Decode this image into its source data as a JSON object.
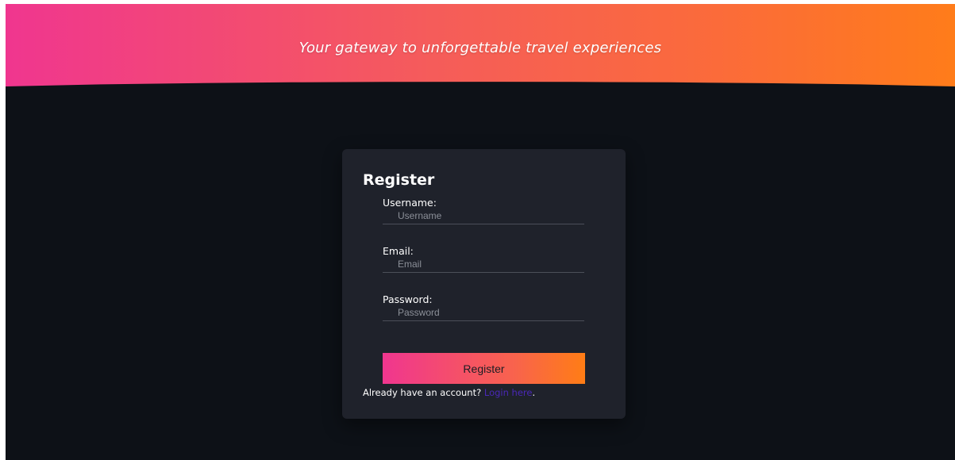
{
  "hero": {
    "tagline": "Your gateway to unforgettable travel experiences"
  },
  "register_form": {
    "title": "Register",
    "username": {
      "label": "Username:",
      "placeholder": "Username",
      "value": ""
    },
    "email": {
      "label": "Email:",
      "placeholder": "Email",
      "value": ""
    },
    "password": {
      "label": "Password:",
      "placeholder": "Password",
      "value": ""
    },
    "submit_label": "Register",
    "login_prompt": "Already have an account?",
    "login_link": "Login here",
    "login_suffix": "."
  },
  "colors": {
    "background": "#0d1117",
    "card": "#1f222b",
    "gradient_start": "#f0368f",
    "gradient_end": "#ff7c1a",
    "link": "#4a28b8"
  }
}
